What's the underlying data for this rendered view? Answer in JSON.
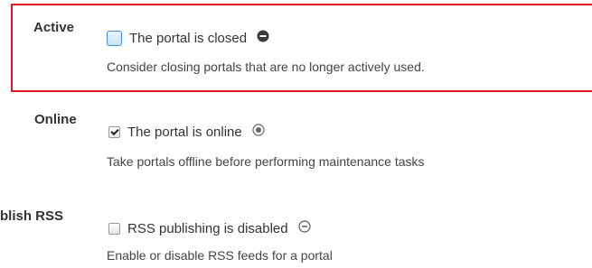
{
  "settings": [
    {
      "label": "Active",
      "checkbox_checked": false,
      "checkbox_text": "The portal is closed",
      "status_icon": "minus-filled-icon",
      "description": "Consider closing portals that are no longer actively used.",
      "highlighted": true
    },
    {
      "label": "Online",
      "checkbox_checked": true,
      "checkbox_text": "The portal is online",
      "status_icon": "radio-dot-icon",
      "description": "Take portals offline before performing maintenance tasks",
      "highlighted": false
    },
    {
      "label": "blish RSS",
      "checkbox_checked": false,
      "checkbox_text": "RSS publishing is disabled",
      "status_icon": "minus-outline-icon",
      "description": "Enable or disable RSS feeds for a portal",
      "highlighted": false
    }
  ],
  "colors": {
    "highlight_border": "#e8151f",
    "text": "#333333"
  }
}
